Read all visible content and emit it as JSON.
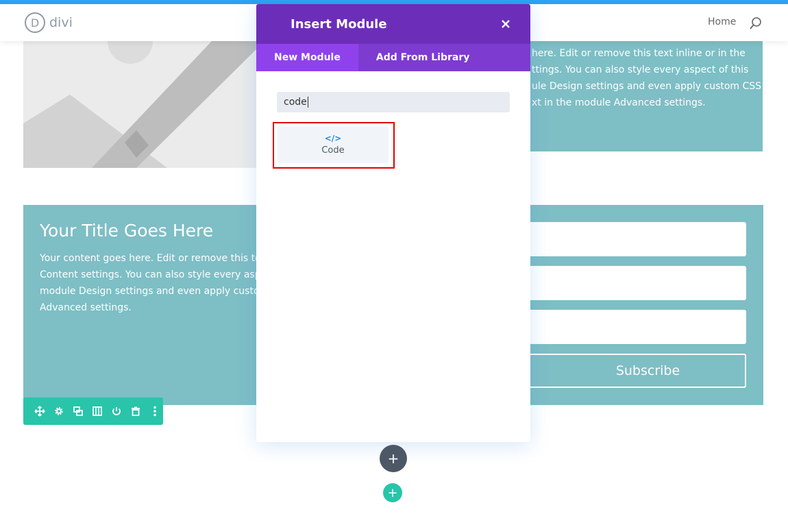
{
  "header": {
    "logo_letter": "D",
    "logo_text": "divi",
    "nav": {
      "home_label": "Home"
    },
    "accent_color": "#2ea3f2"
  },
  "section_top": {
    "text_lines": [
      "here. Edit or remove this text inline or in the",
      "ttings. You can also style every aspect of this",
      "ule Design settings and even apply custom CSS",
      "xt in the module Advanced settings."
    ]
  },
  "cta": {
    "title": "Your Title Goes Here",
    "body_lines": [
      "Your content goes here. Edit or remove this text",
      "Content settings. You can also style every aspect",
      "module Design settings and even apply custom C",
      "Advanced settings."
    ],
    "bg_color": "#7ebec5"
  },
  "form": {
    "subscribe_label": "Subscribe"
  },
  "row_toolbar": {
    "color": "#29c4a9",
    "icons": [
      "move-icon",
      "gear-icon",
      "duplicate-icon",
      "columns-icon",
      "power-icon",
      "trash-icon",
      "more-icon"
    ]
  },
  "modal": {
    "title": "Insert Module",
    "tabs": [
      {
        "label": "New Module",
        "active": true
      },
      {
        "label": "Add From Library",
        "active": false
      }
    ],
    "search_value": "code",
    "results": [
      {
        "icon": "code-icon",
        "glyph": "</>",
        "label": "Code"
      }
    ],
    "header_color": "#6c2eb9",
    "highlight_color": "#e00000"
  },
  "add_buttons": {
    "add_module_glyph": "+",
    "add_row_glyph": "+"
  }
}
